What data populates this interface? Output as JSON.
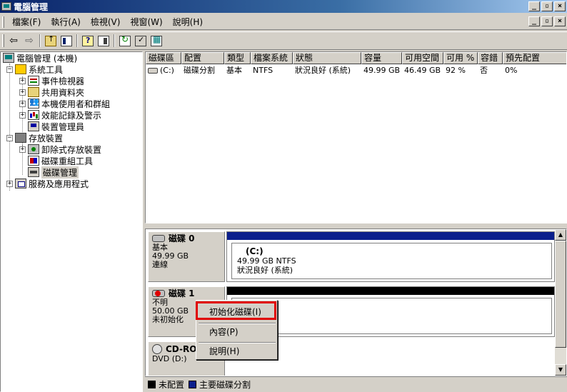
{
  "window": {
    "title": "電腦管理",
    "controls": {
      "minimize": "_",
      "restore": "▫",
      "close": "×"
    }
  },
  "menu": [
    "檔案(F)",
    "執行(A)",
    "檢視(V)",
    "視窗(W)",
    "說明(H)"
  ],
  "mdi_controls": {
    "minimize": "_",
    "restore": "▫",
    "close": "×"
  },
  "toolbar": {
    "back": "⇦",
    "forward": "⇨"
  },
  "tree": {
    "root": "電腦管理 (本機)",
    "system_tools": "系統工具",
    "event_viewer": "事件檢視器",
    "shared_folders": "共用資料夾",
    "local_users": "本機使用者和群組",
    "perf_logs": "效能記錄及警示",
    "device_manager": "裝置管理員",
    "storage": "存放裝置",
    "removable_storage": "卸除式存放裝置",
    "defrag": "磁碟重組工具",
    "disk_management": "磁碟管理",
    "services_apps": "服務及應用程式",
    "expand": "+",
    "collapse": "−"
  },
  "volume_list": {
    "columns": [
      "磁碟區",
      "配置",
      "類型",
      "檔案系統",
      "狀態",
      "容量",
      "可用空間",
      "可用 %",
      "容錯",
      "預先配置"
    ],
    "rows": [
      [
        "(C:)",
        "磁碟分割",
        "基本",
        "NTFS",
        "狀況良好 (系統)",
        "49.99 GB",
        "46.49 GB",
        "92 %",
        "否",
        "0%"
      ]
    ]
  },
  "disks": [
    {
      "name": "磁碟 0",
      "type": "基本",
      "size": "49.99 GB",
      "status": "連線",
      "partition": {
        "label": "(C:)",
        "detail": "49.99 GB NTFS",
        "status": "狀況良好 (系統)"
      }
    },
    {
      "name": "磁碟 1",
      "type": "不明",
      "size": "50.00 GB",
      "status": "未初始化"
    },
    {
      "name": "CD-RO",
      "type": "DVD (D:)"
    }
  ],
  "context_menu": {
    "initialize": "初始化磁碟(I)",
    "properties": "內容(P)",
    "help": "說明(H)"
  },
  "legend": {
    "unallocated": "未配置",
    "primary": "主要磁碟分割",
    "colors": {
      "unallocated": "#000000",
      "primary": "#0a1e8c"
    }
  },
  "colors": {
    "title_bar": "#0a246a",
    "highlight_box": "#e00000",
    "window_face": "#d4d0c8"
  }
}
